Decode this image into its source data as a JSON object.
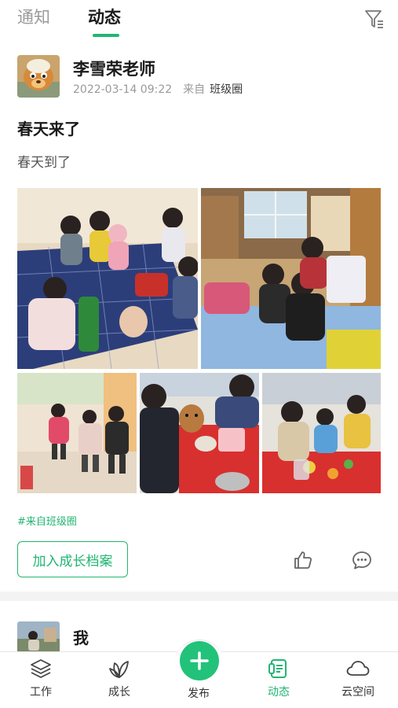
{
  "tabs": {
    "notice": "通知",
    "feed": "动态"
  },
  "post": {
    "author": "李雪荣老师",
    "datetime": "2022-03-14 09:22",
    "source_prefix": "来自",
    "source": "班级圈",
    "title": "春天来了",
    "body": "春天到了",
    "hashtag": "#来自班级圈",
    "archive_button": "加入成长档案",
    "photos": [
      "classroom-play-mat",
      "children-reading-corner",
      "children-lining-up",
      "children-with-toys",
      "children-at-table"
    ]
  },
  "post2": {
    "author": "我"
  },
  "nav": {
    "work": "工作",
    "growth": "成长",
    "publish": "发布",
    "feed": "动态",
    "cloud": "云空间"
  },
  "colors": {
    "accent": "#22b573",
    "muted": "#9a9a9a",
    "text": "#1a1a1a"
  },
  "icons": [
    "filter-icon",
    "like-icon",
    "comment-icon",
    "layers-icon",
    "leaf-icon",
    "plus-icon",
    "feed-doc-icon",
    "cloud-icon"
  ]
}
